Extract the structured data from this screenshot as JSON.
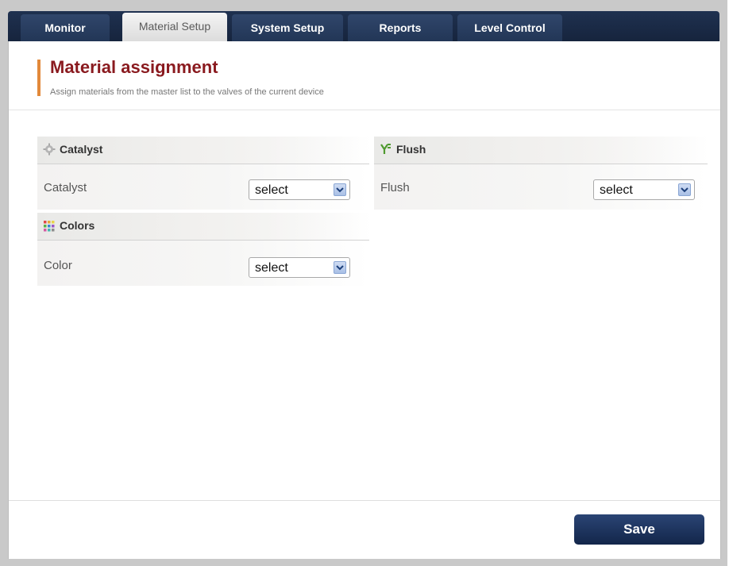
{
  "tabs": [
    {
      "label": "Monitor",
      "active": false
    },
    {
      "label": "Material Setup",
      "active": true
    },
    {
      "label": "System Setup",
      "active": false
    },
    {
      "label": "Reports",
      "active": false
    },
    {
      "label": "Level Control",
      "active": false
    }
  ],
  "header": {
    "title": "Material assignment",
    "subtitle": "Assign materials from the master list to the valves of the current device"
  },
  "sections": {
    "catalyst": {
      "title": "Catalyst",
      "icon": "gear-icon",
      "field_label": "Catalyst",
      "select_value": "select"
    },
    "flush": {
      "title": "Flush",
      "icon": "valve-icon",
      "field_label": "Flush",
      "select_value": "select"
    },
    "colors": {
      "title": "Colors",
      "icon": "color-grid-icon",
      "field_label": "Color",
      "select_value": "select"
    }
  },
  "footer": {
    "save_label": "Save"
  },
  "colors": {
    "tab_bg": "#223656",
    "title": "#8a1a1f",
    "accent": "#e2893a",
    "save_bg": "#1c325c"
  }
}
